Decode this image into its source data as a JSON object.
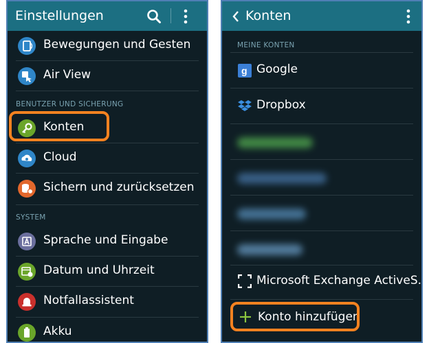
{
  "left": {
    "title": "Einstellungen",
    "items_top": [
      {
        "label": "Bewegungen und Gesten"
      },
      {
        "label": "Air View"
      }
    ],
    "section_user": "BENUTZER UND SICHERUNG",
    "items_user": [
      {
        "label": "Konten"
      },
      {
        "label": "Cloud"
      },
      {
        "label": "Sichern und zurücksetzen"
      }
    ],
    "section_system": "SYSTEM",
    "items_system": [
      {
        "label": "Sprache und Eingabe"
      },
      {
        "label": "Datum und Uhrzeit"
      },
      {
        "label": "Notfallassistent"
      },
      {
        "label": "Akku"
      }
    ]
  },
  "right": {
    "title": "Konten",
    "section_my": "MEINE KONTEN",
    "accounts": [
      {
        "label": "Google"
      },
      {
        "label": "Dropbox"
      },
      {
        "label": "Microsoft Exchange ActiveS.."
      }
    ],
    "add_label": "Konto hinzufügen"
  },
  "colors": {
    "actionbar": "#1c6f82",
    "background": "#0f1e25",
    "highlight": "#f58220",
    "section_text": "#7aa3b1",
    "add_plus": "#8cc63f"
  }
}
